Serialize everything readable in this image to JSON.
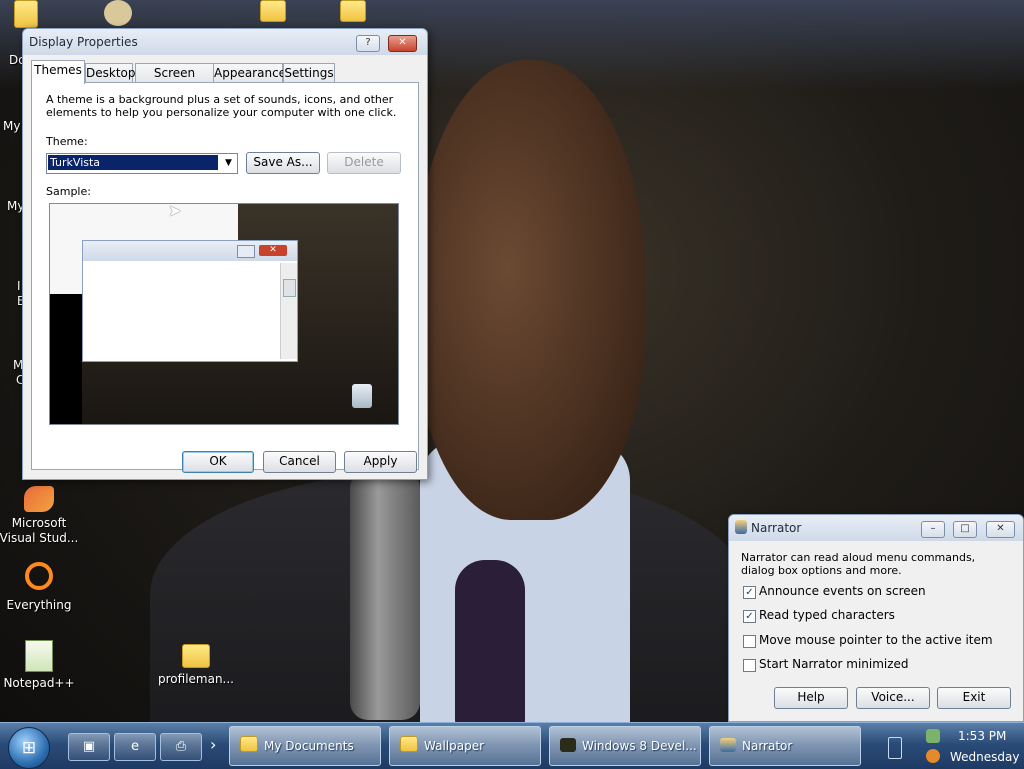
{
  "desktop": {
    "icons": [
      {
        "label": "Microsoft Visual Stud...",
        "icon": "visual-studio-icon"
      },
      {
        "label": "Everything",
        "icon": "everything-search-icon"
      },
      {
        "label": "Notepad++",
        "icon": "notepad-plus-plus-icon"
      },
      {
        "label": "profileman...",
        "icon": "folder-icon"
      }
    ],
    "partial_labels": [
      "Do",
      "My",
      "My",
      "I",
      "E",
      "M",
      "C"
    ]
  },
  "display_properties": {
    "title": "Display Properties",
    "help_btn": "?",
    "close_btn": "✕",
    "tabs": [
      "Themes",
      "Desktop",
      "Screen Saver",
      "Appearance",
      "Settings"
    ],
    "active_tab": "Themes",
    "description": "A theme is a background plus a set of sounds, icons, and other elements to help you personalize your computer with one click.",
    "theme_label": "Theme:",
    "theme_value": "TurkVista",
    "save_as": "Save As...",
    "delete": "Delete",
    "sample_label": "Sample:",
    "ok": "OK",
    "cancel": "Cancel",
    "apply": "Apply"
  },
  "narrator": {
    "title": "Narrator",
    "description": "Narrator can read aloud menu commands, dialog box options and more.",
    "options": [
      {
        "label": "Announce events on screen",
        "checked": true
      },
      {
        "label": "Read typed characters",
        "checked": true
      },
      {
        "label": "Move mouse pointer to the active item",
        "checked": false
      },
      {
        "label": "Start Narrator minimized",
        "checked": false
      }
    ],
    "check_glyph": "✓",
    "help": "Help",
    "voice": "Voice...",
    "exit": "Exit"
  },
  "taskbar": {
    "start_glyph": "⊞",
    "quick_launch": [
      "show-desktop-icon",
      "internet-explorer-icon",
      "printer-icon"
    ],
    "chevron": "›",
    "tasks": [
      {
        "label": "My Documents",
        "icon": "folder-icon"
      },
      {
        "label": "Wallpaper",
        "icon": "folder-icon"
      },
      {
        "label": "Windows 8 Devel...",
        "icon": "app-icon"
      },
      {
        "label": "Narrator",
        "icon": "narrator-icon"
      }
    ],
    "clock_time": "1:53 PM",
    "clock_day": "Wednesday"
  },
  "colors": {
    "selection": "#0a246a",
    "taskbar": "#2b4c78"
  }
}
